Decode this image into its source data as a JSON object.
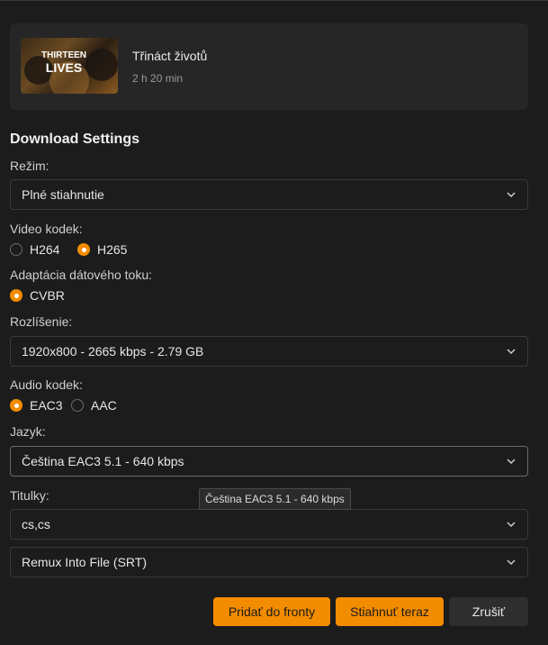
{
  "movie": {
    "poster_text_1": "THIRTEEN",
    "poster_text_2": "LIVES",
    "title": "Třináct životů",
    "duration": "2 h 20 min"
  },
  "settings": {
    "heading": "Download Settings",
    "mode": {
      "label": "Režim:",
      "value": "Plné stiahnutie"
    },
    "video_codec": {
      "label": "Video kodek:",
      "options": [
        {
          "label": "H264",
          "checked": false
        },
        {
          "label": "H265",
          "checked": true
        }
      ]
    },
    "bitrate_adaptation": {
      "label": "Adaptácia dátového toku:",
      "options": [
        {
          "label": "CVBR",
          "checked": true
        }
      ]
    },
    "resolution": {
      "label": "Rozlíšenie:",
      "value": "1920x800 - 2665 kbps - 2.79 GB"
    },
    "audio_codec": {
      "label": "Audio kodek:",
      "options": [
        {
          "label": "EAC3",
          "checked": true
        },
        {
          "label": "AAC",
          "checked": false
        }
      ]
    },
    "language": {
      "label": "Jazyk:",
      "value": "Čeština EAC3 5.1 - 640 kbps",
      "tooltip": "Čeština EAC3 5.1 - 640 kbps"
    },
    "subtitles": {
      "label": "Titulky:",
      "value": "cs,cs"
    },
    "subtitle_mode": {
      "value": "Remux Into File (SRT)"
    }
  },
  "actions": {
    "add_to_queue": "Pridať do fronty",
    "download_now": "Stiahnuť teraz",
    "cancel": "Zrušiť"
  },
  "colors": {
    "accent": "#f28c00",
    "background": "#1c1c1c",
    "card": "#262626"
  },
  "icons": {
    "select_chevron": "chevron-down-icon"
  }
}
